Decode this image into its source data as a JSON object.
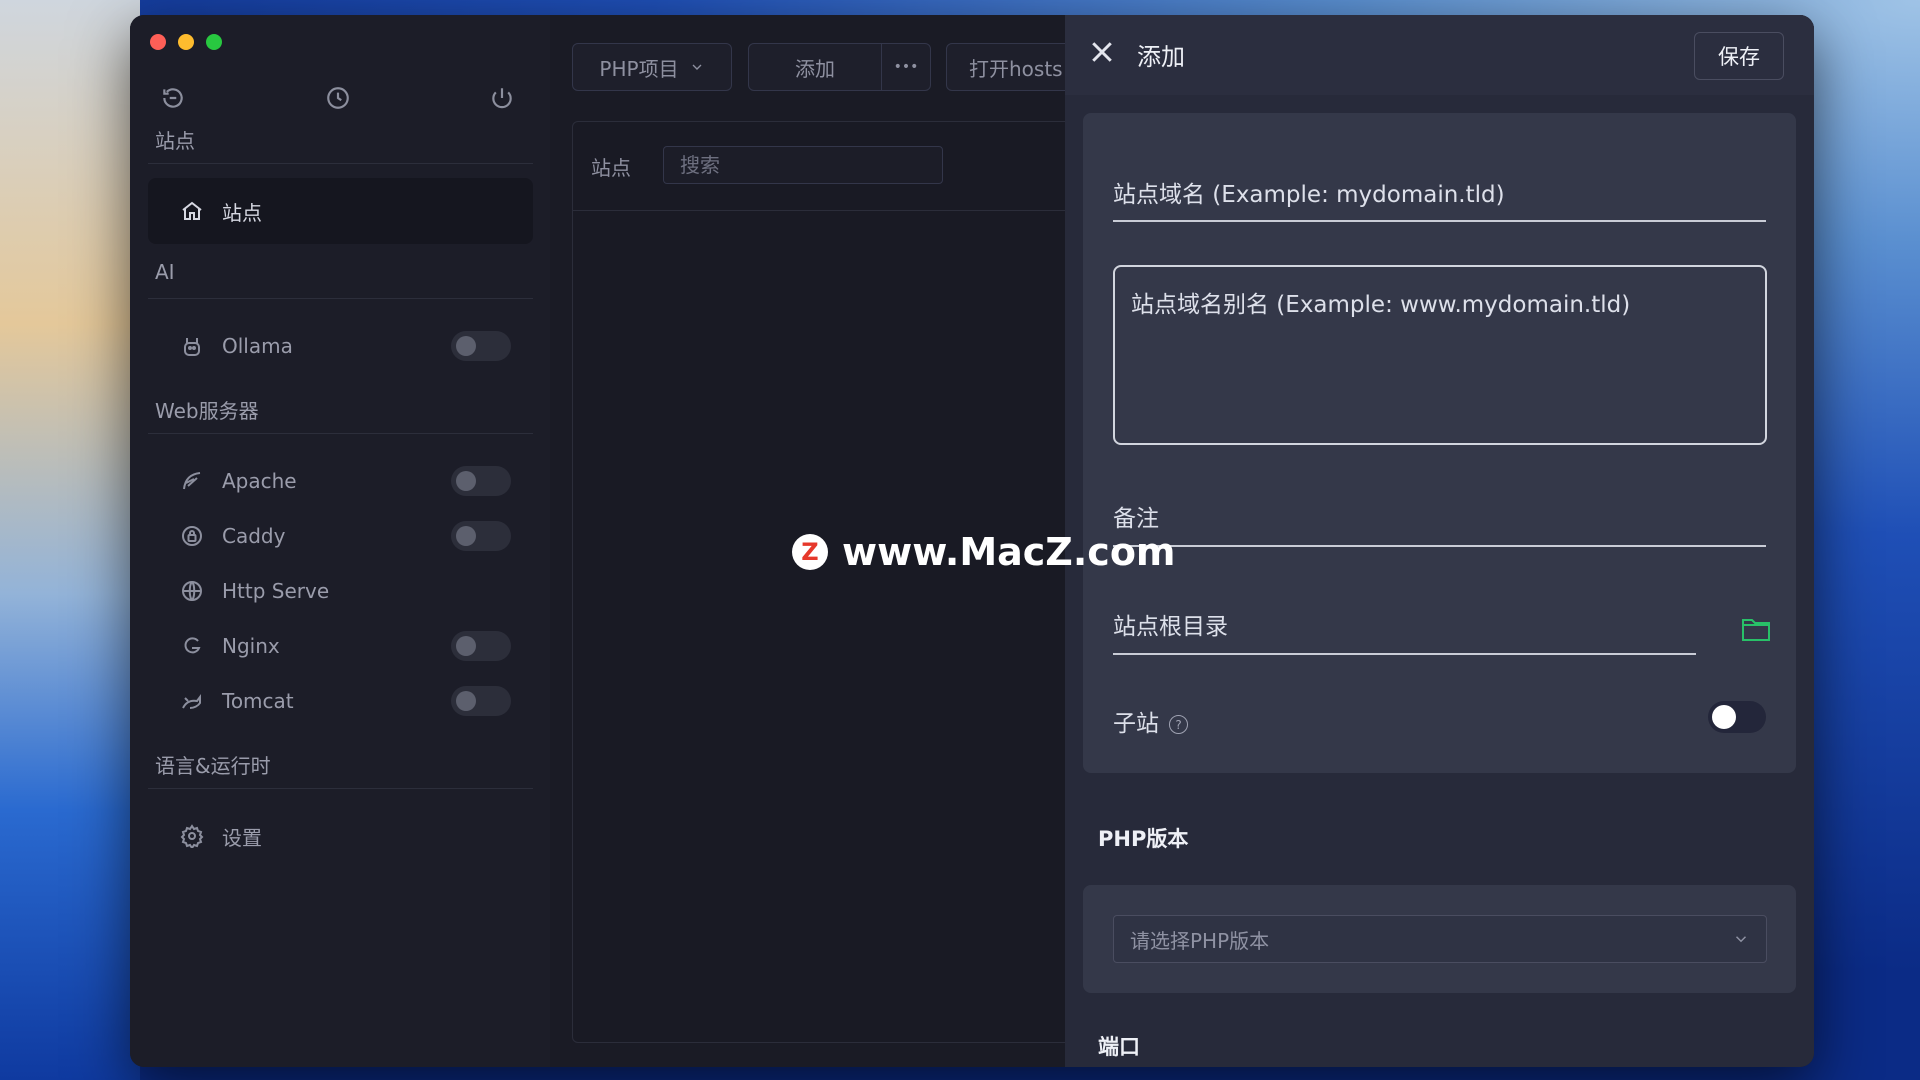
{
  "window": {
    "traffic_lights": [
      "close",
      "minimize",
      "zoom"
    ]
  },
  "sidebar": {
    "top_icons": [
      "back-icon",
      "history-icon",
      "power-icon"
    ],
    "sections": [
      {
        "title": "站点",
        "items": [
          {
            "label": "站点",
            "icon": "home-icon",
            "active": true
          }
        ]
      },
      {
        "title": "AI",
        "items": [
          {
            "label": "Ollama",
            "icon": "llama-icon",
            "toggle": false
          }
        ]
      },
      {
        "title": "Web服务器",
        "items": [
          {
            "label": "Apache",
            "icon": "feather-icon",
            "toggle": false
          },
          {
            "label": "Caddy",
            "icon": "lock-icon",
            "toggle": false
          },
          {
            "label": "Http Serve",
            "icon": "globe-icon"
          },
          {
            "label": "Nginx",
            "icon": "nginx-icon",
            "toggle": false
          },
          {
            "label": "Tomcat",
            "icon": "cat-icon",
            "toggle": false
          }
        ]
      },
      {
        "title": "语言&运行时",
        "items": [
          {
            "label": "设置",
            "icon": "gear-icon"
          }
        ]
      }
    ]
  },
  "toolbar": {
    "php_project": "PHP项目",
    "add": "添加",
    "more": "•••",
    "open_hosts": "打开hosts"
  },
  "site_list": {
    "label": "站点",
    "search_placeholder": "搜索"
  },
  "watermark": {
    "badge": "Z",
    "text": "www.MacZ.com"
  },
  "add_panel": {
    "title": "添加",
    "save": "保存",
    "domain_placeholder": "站点域名 (Example: mydomain.tld)",
    "alias_placeholder": "站点域名别名 (Example: www.mydomain.tld)",
    "note": "备注",
    "root_dir": "站点根目录",
    "sub_site": "子站",
    "sub_site_enabled": false,
    "help": "?",
    "php_version_label": "PHP版本",
    "php_version_placeholder": "请选择PHP版本",
    "port_label": "端口"
  },
  "colors": {
    "accent_green": "#28c168",
    "sidebar_bg": "#1c1d28",
    "panel_bg": "#272a3a"
  }
}
